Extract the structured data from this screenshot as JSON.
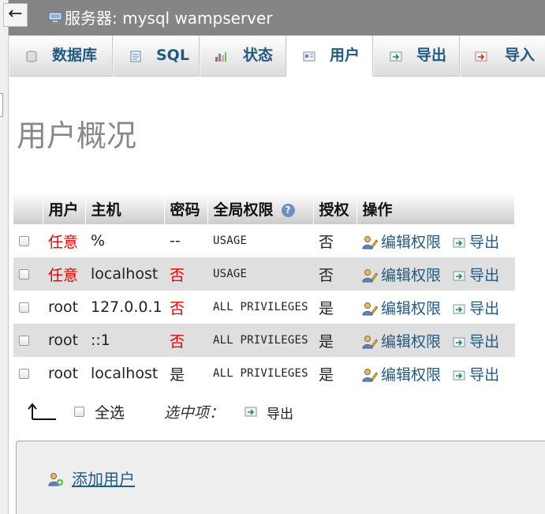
{
  "titlebar": {
    "back_glyph": "←",
    "title": "服务器: mysql wampserver",
    "icon": "server-icon"
  },
  "tabs": [
    {
      "label": "数据库",
      "icon": "database-icon",
      "active": false
    },
    {
      "label": "SQL",
      "icon": "sql-icon",
      "active": false
    },
    {
      "label": "状态",
      "icon": "status-icon",
      "active": false
    },
    {
      "label": "用户",
      "icon": "users-icon",
      "active": true
    },
    {
      "label": "导出",
      "icon": "export-icon",
      "active": false
    },
    {
      "label": "导入",
      "icon": "import-icon",
      "active": false
    }
  ],
  "page": {
    "heading": "用户概况"
  },
  "table": {
    "columns": [
      "用户",
      "主机",
      "密码",
      "全局权限",
      "授权",
      "操作"
    ],
    "help_glyph": "?",
    "rows": [
      {
        "user": "任意",
        "host": "%",
        "password": "--",
        "privileges": "USAGE",
        "grant": "否",
        "edit": "编辑权限",
        "export": "导出"
      },
      {
        "user": "任意",
        "host": "localhost",
        "password": "否",
        "privileges": "USAGE",
        "grant": "否",
        "edit": "编辑权限",
        "export": "导出"
      },
      {
        "user": "root",
        "host": "127.0.0.1",
        "password": "否",
        "privileges": "ALL PRIVILEGES",
        "grant": "是",
        "edit": "编辑权限",
        "export": "导出"
      },
      {
        "user": "root",
        "host": "::1",
        "password": "否",
        "privileges": "ALL PRIVILEGES",
        "grant": "是",
        "edit": "编辑权限",
        "export": "导出"
      },
      {
        "user": "root",
        "host": "localhost",
        "password": "是",
        "privileges": "ALL PRIVILEGES",
        "grant": "是",
        "edit": "编辑权限",
        "export": "导出"
      }
    ]
  },
  "bulk": {
    "select_all": "全选",
    "with_selected": "选中项：",
    "export": "导出"
  },
  "add_user": {
    "label": "添加用户"
  },
  "colors": {
    "link": "#235a81",
    "warning_red": "#dd0000",
    "titlebar_bg": "#858585",
    "row_alt": "#dfdfdf"
  }
}
